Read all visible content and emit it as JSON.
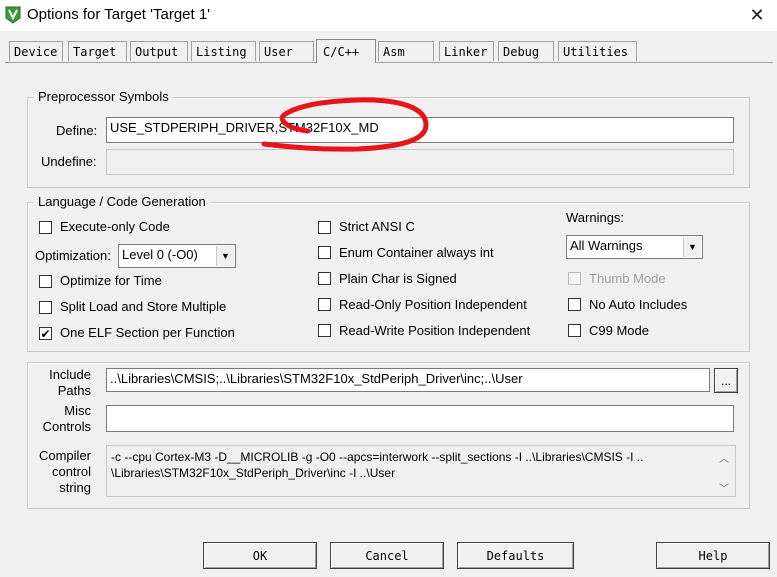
{
  "window": {
    "title": "Options for Target 'Target 1'",
    "close_glyph": "✕"
  },
  "tabs": [
    "Device",
    "Target",
    "Output",
    "Listing",
    "User",
    "C/C++",
    "Asm",
    "Linker",
    "Debug",
    "Utilities"
  ],
  "active_tab": "C/C++",
  "preprocessor": {
    "group_title": "Preprocessor Symbols",
    "define_label": "Define:",
    "define_value": "USE_STDPERIPH_DRIVER,STM32F10X_MD",
    "undefine_label": "Undefine:",
    "undefine_value": ""
  },
  "language": {
    "group_title": "Language / Code Generation",
    "execute_only": {
      "label": "Execute-only Code",
      "checked": false
    },
    "optimization_label": "Optimization:",
    "optimization_value": "Level 0 (-O0)",
    "optimize_time": {
      "label": "Optimize for Time",
      "checked": false
    },
    "split_load": {
      "label": "Split Load and Store Multiple",
      "checked": false
    },
    "one_elf": {
      "label": "One ELF Section per Function",
      "checked": true
    },
    "strict_ansi": {
      "label": "Strict ANSI C",
      "checked": false
    },
    "enum_container": {
      "label": "Enum Container always int",
      "checked": false
    },
    "plain_char": {
      "label": "Plain Char is Signed",
      "checked": false
    },
    "ro_pos": {
      "label": "Read-Only Position Independent",
      "checked": false
    },
    "rw_pos": {
      "label": "Read-Write Position Independent",
      "checked": false
    },
    "warnings_label": "Warnings:",
    "warnings_value": "All Warnings",
    "thumb_mode": {
      "label": "Thumb Mode",
      "checked": false,
      "disabled": true
    },
    "no_auto_includes": {
      "label": "No Auto Includes",
      "checked": false
    },
    "c99_mode": {
      "label": "C99 Mode",
      "checked": false
    }
  },
  "paths": {
    "include_label_1": "Include",
    "include_label_2": "Paths",
    "include_value": "..\\Libraries\\CMSIS;..\\Libraries\\STM32F10x_StdPeriph_Driver\\inc;..\\User",
    "browse_label": "...",
    "misc_label_1": "Misc",
    "misc_label_2": "Controls",
    "misc_value": "",
    "compiler_label_1": "Compiler",
    "compiler_label_2": "control",
    "compiler_label_3": "string",
    "compiler_line_1": "-c --cpu Cortex-M3 -D__MICROLIB -g -O0 --apcs=interwork --split_sections -I ..\\Libraries\\CMSIS -I ..",
    "compiler_line_2": "\\Libraries\\STM32F10x_StdPeriph_Driver\\inc -I ..\\User"
  },
  "buttons": {
    "ok": "OK",
    "cancel": "Cancel",
    "defaults": "Defaults",
    "help": "Help"
  },
  "colors": {
    "annotation_red": "#e8141b",
    "icon_green": "#3a9b3a"
  }
}
